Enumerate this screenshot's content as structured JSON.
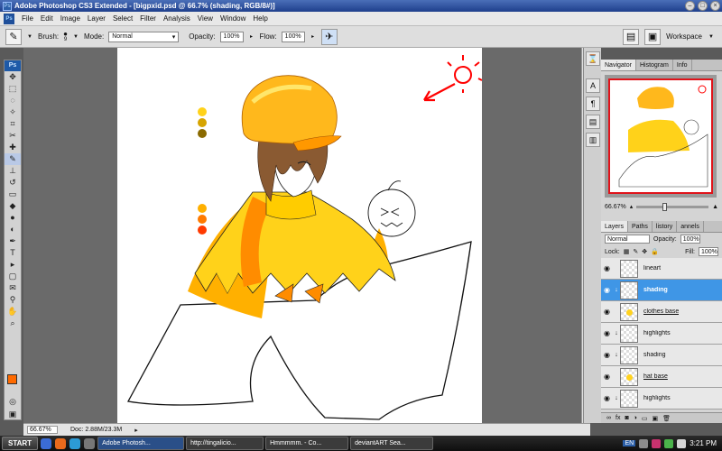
{
  "window": {
    "title": "Adobe Photoshop CS3 Extended - [bigpxid.psd @ 66.7% (shading, RGB/8#)]"
  },
  "menu": {
    "items": [
      "File",
      "Edit",
      "Image",
      "Layer",
      "Select",
      "Filter",
      "Analysis",
      "View",
      "Window",
      "Help"
    ]
  },
  "options": {
    "brush_label": "Brush:",
    "brush_size": "9",
    "mode_label": "Mode:",
    "mode_value": "Normal",
    "opacity_label": "Opacity:",
    "opacity_value": "100%",
    "flow_label": "Flow:",
    "flow_value": "100%",
    "workspace_label": "Workspace"
  },
  "status": {
    "zoom": "66.67%",
    "doc": "Doc: 2.88M/23.3M"
  },
  "navigator": {
    "tabs": [
      "Navigator",
      "Histogram",
      "Info"
    ],
    "zoom": "66.67%"
  },
  "layers": {
    "tabs": [
      "Layers",
      "Paths",
      "listory",
      "annels"
    ],
    "blend_mode": "Normal",
    "opacity_label": "Opacity:",
    "opacity_value": "100%",
    "lock_label": "Lock:",
    "fill_label": "Fill:",
    "fill_value": "100%",
    "items": [
      {
        "name": "lineart",
        "clipped": false,
        "selected": false,
        "underline": false,
        "has_content": false
      },
      {
        "name": "shading",
        "clipped": true,
        "selected": true,
        "underline": false,
        "has_content": false
      },
      {
        "name": "clothes base",
        "clipped": false,
        "selected": false,
        "underline": true,
        "has_content": true
      },
      {
        "name": "highlights",
        "clipped": true,
        "selected": false,
        "underline": false,
        "has_content": false
      },
      {
        "name": "shading",
        "clipped": true,
        "selected": false,
        "underline": false,
        "has_content": false
      },
      {
        "name": "hat base",
        "clipped": false,
        "selected": false,
        "underline": true,
        "has_content": true
      },
      {
        "name": "highlights",
        "clipped": true,
        "selected": false,
        "underline": false,
        "has_content": false
      }
    ]
  },
  "taskbar": {
    "start": "START",
    "tasks": [
      "Adobe Photosh...",
      "http://tingalicio...",
      "Hmmmmm. - Co...",
      "deviantART Sea..."
    ],
    "lang": "EN",
    "clock": "3:21 PM"
  },
  "colors": {
    "foreground": "#ff6a00",
    "background": "#ffffff",
    "selected_layer": "#3f96e6"
  }
}
